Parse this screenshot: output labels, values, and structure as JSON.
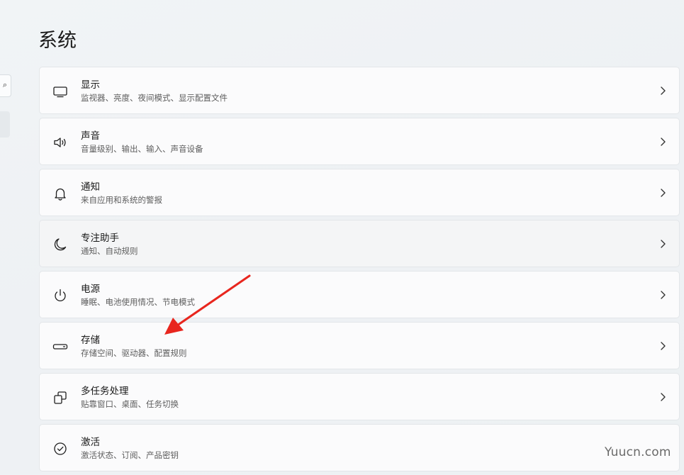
{
  "page": {
    "title": "系统"
  },
  "settings": [
    {
      "title": "显示",
      "subtitle": "监视器、亮度、夜间模式、显示配置文件",
      "icon": "monitor-icon"
    },
    {
      "title": "声音",
      "subtitle": "音量级别、输出、输入、声音设备",
      "icon": "speaker-icon"
    },
    {
      "title": "通知",
      "subtitle": "来自应用和系统的警报",
      "icon": "bell-icon"
    },
    {
      "title": "专注助手",
      "subtitle": "通知、自动规则",
      "icon": "moon-icon"
    },
    {
      "title": "电源",
      "subtitle": "睡眠、电池使用情况、节电模式",
      "icon": "power-icon"
    },
    {
      "title": "存储",
      "subtitle": "存储空间、驱动器、配置规则",
      "icon": "drive-icon"
    },
    {
      "title": "多任务处理",
      "subtitle": "贴靠窗口、桌面、任务切换",
      "icon": "multitask-icon"
    },
    {
      "title": "激活",
      "subtitle": "激活状态、订阅、产品密钥",
      "icon": "check-circle-icon"
    }
  ],
  "annotation": {
    "color": "#e8261e",
    "points_to": "存储"
  },
  "watermark": {
    "text": "Yuucn.com"
  }
}
